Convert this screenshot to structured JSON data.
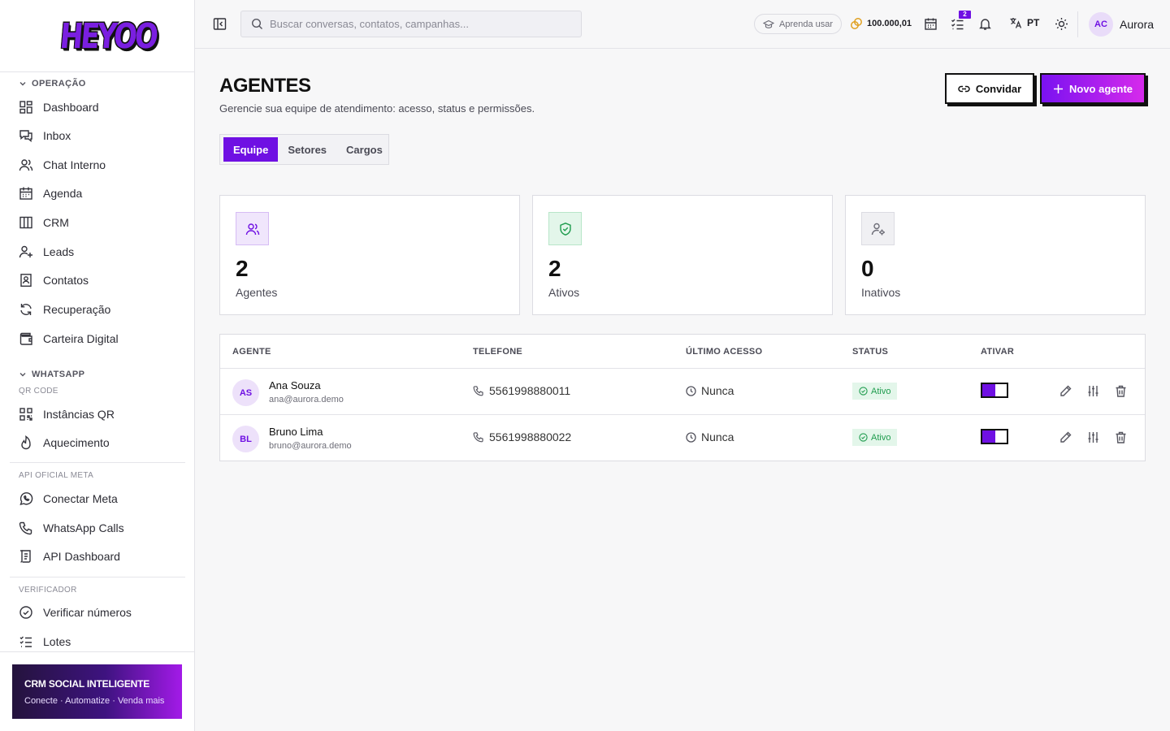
{
  "brand": {
    "logo_text": "HEYOO"
  },
  "sidebar": {
    "sections": [
      {
        "label": "OPERAÇÃO"
      },
      {
        "label": "WHATSAPP"
      },
      {
        "label": "QR CODE"
      },
      {
        "label": "API OFICIAL META"
      },
      {
        "label": "VERIFICADOR"
      }
    ],
    "items": [
      {
        "label": "Dashboard",
        "icon": "dashboard-icon"
      },
      {
        "label": "Inbox",
        "icon": "inbox-icon"
      },
      {
        "label": "Chat Interno",
        "icon": "users-icon"
      },
      {
        "label": "Agenda",
        "icon": "calendar-icon"
      },
      {
        "label": "CRM",
        "icon": "kanban-icon"
      },
      {
        "label": "Leads",
        "icon": "user-plus-icon"
      },
      {
        "label": "Contatos",
        "icon": "contact-book-icon"
      },
      {
        "label": "Recuperação",
        "icon": "refresh-icon"
      },
      {
        "label": "Carteira Digital",
        "icon": "wallet-icon"
      },
      {
        "label": "Instâncias QR",
        "icon": "qr-code-icon"
      },
      {
        "label": "Aquecimento",
        "icon": "flame-icon"
      },
      {
        "label": "Conectar Meta",
        "icon": "whatsapp-icon"
      },
      {
        "label": "WhatsApp Calls",
        "icon": "phone-icon"
      },
      {
        "label": "API Dashboard",
        "icon": "api-icon"
      },
      {
        "label": "Verificar números",
        "icon": "check-circle-icon"
      },
      {
        "label": "Lotes",
        "icon": "list-check-icon"
      }
    ],
    "promo": {
      "title": "CRM SOCIAL INTELIGENTE",
      "subtitle": "Conecte · Automatize · Venda mais"
    }
  },
  "topbar": {
    "search_placeholder": "Buscar conversas, contatos, campanhas...",
    "learn_label": "Aprenda usar",
    "coins": "100.000,01",
    "tasks_badge": "2",
    "language": "PT",
    "user_initials": "AC",
    "user_name": "Aurora"
  },
  "page": {
    "title": "AGENTES",
    "subtitle": "Gerencie sua equipe de atendimento: acesso, status e permissões.",
    "invite_label": "Convidar",
    "new_agent_label": "Novo agente",
    "tabs": [
      {
        "label": "Equipe",
        "active": true
      },
      {
        "label": "Setores",
        "active": false
      },
      {
        "label": "Cargos",
        "active": false
      }
    ]
  },
  "stats": [
    {
      "value": "2",
      "label": "Agentes",
      "icon": "users-icon",
      "color": "#6f10e3"
    },
    {
      "value": "2",
      "label": "Ativos",
      "icon": "shield-check-icon",
      "color": "#1f9c4e"
    },
    {
      "value": "0",
      "label": "Inativos",
      "icon": "user-cog-icon",
      "color": "#6e6e78"
    }
  ],
  "table": {
    "headers": [
      "AGENTE",
      "TELEFONE",
      "ÚLTIMO ACESSO",
      "STATUS",
      "ATIVAR"
    ],
    "rows": [
      {
        "initials": "AS",
        "name": "Ana Souza",
        "email": "ana@aurora.demo",
        "phone": "5561998880011",
        "last_access": "Nunca",
        "status": "Ativo",
        "enabled": true
      },
      {
        "initials": "BL",
        "name": "Bruno Lima",
        "email": "bruno@aurora.demo",
        "phone": "5561998880022",
        "last_access": "Nunca",
        "status": "Ativo",
        "enabled": true
      }
    ]
  }
}
